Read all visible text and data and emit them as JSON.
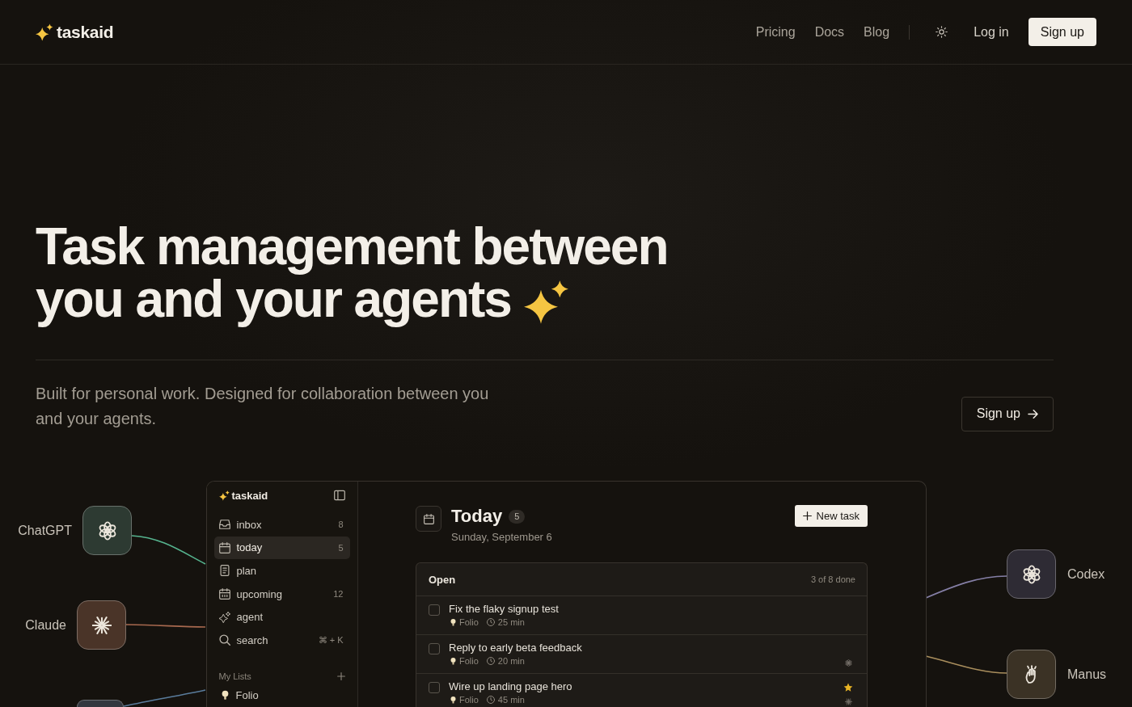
{
  "header": {
    "logo": "taskaid",
    "nav": [
      {
        "label": "Pricing"
      },
      {
        "label": "Docs"
      },
      {
        "label": "Blog"
      }
    ],
    "login": "Log in",
    "signup": "Sign up"
  },
  "hero": {
    "title_lines": [
      "Task management between",
      "you and your agents"
    ],
    "subtitle": "Built for personal work. Designed for collaboration between you and your agents.",
    "cta": "Sign up"
  },
  "app": {
    "sidebar": {
      "logo": "taskaid",
      "items": [
        {
          "label": "inbox",
          "count": "8",
          "selected": false
        },
        {
          "label": "today",
          "count": "5",
          "selected": true
        },
        {
          "label": "plan",
          "selected": false
        },
        {
          "label": "upcoming",
          "count": "12",
          "selected": false
        },
        {
          "label": "agent",
          "selected": false
        },
        {
          "label": "search",
          "shortcut": "⌘ + K",
          "selected": false
        }
      ],
      "lists_title": "My Lists",
      "lists": [
        {
          "label": "Folio"
        }
      ]
    },
    "main": {
      "title": "Today",
      "count": "5",
      "date": "Sunday, September 6",
      "new_task": "New task",
      "section": {
        "title": "Open",
        "progress": "3 of 8 done",
        "tasks": [
          {
            "title": "Fix the flaky signup test",
            "list": "Folio",
            "duration": "25 min",
            "checked": false
          },
          {
            "title": "Reply to early beta feedback",
            "list": "Folio",
            "duration": "20 min",
            "checked": false,
            "markers": [
              {
                "kind": "knot"
              }
            ]
          },
          {
            "title": "Wire up landing page hero",
            "list": "Folio",
            "duration": "45 min",
            "checked": false,
            "markers": [
              {
                "kind": "star"
              },
              {
                "kind": "burst"
              }
            ]
          }
        ]
      }
    }
  },
  "agents_left": [
    {
      "name": "ChatGPT",
      "color": "#2d3a32",
      "connector": {
        "color": "#56b48f"
      }
    },
    {
      "name": "Claude",
      "color": "#4a3428",
      "connector": {
        "color": "#a8694f"
      }
    },
    {
      "color": "#33373f",
      "connector": {
        "color": "#5a7c9c"
      }
    }
  ],
  "agents_right": [
    {
      "name": "Codex",
      "color": "#2e2b34",
      "connector": {
        "color": "#857fa6"
      }
    },
    {
      "name": "Manus",
      "color": "#3b3225",
      "connector": {
        "color": "#a98e5d"
      }
    }
  ]
}
